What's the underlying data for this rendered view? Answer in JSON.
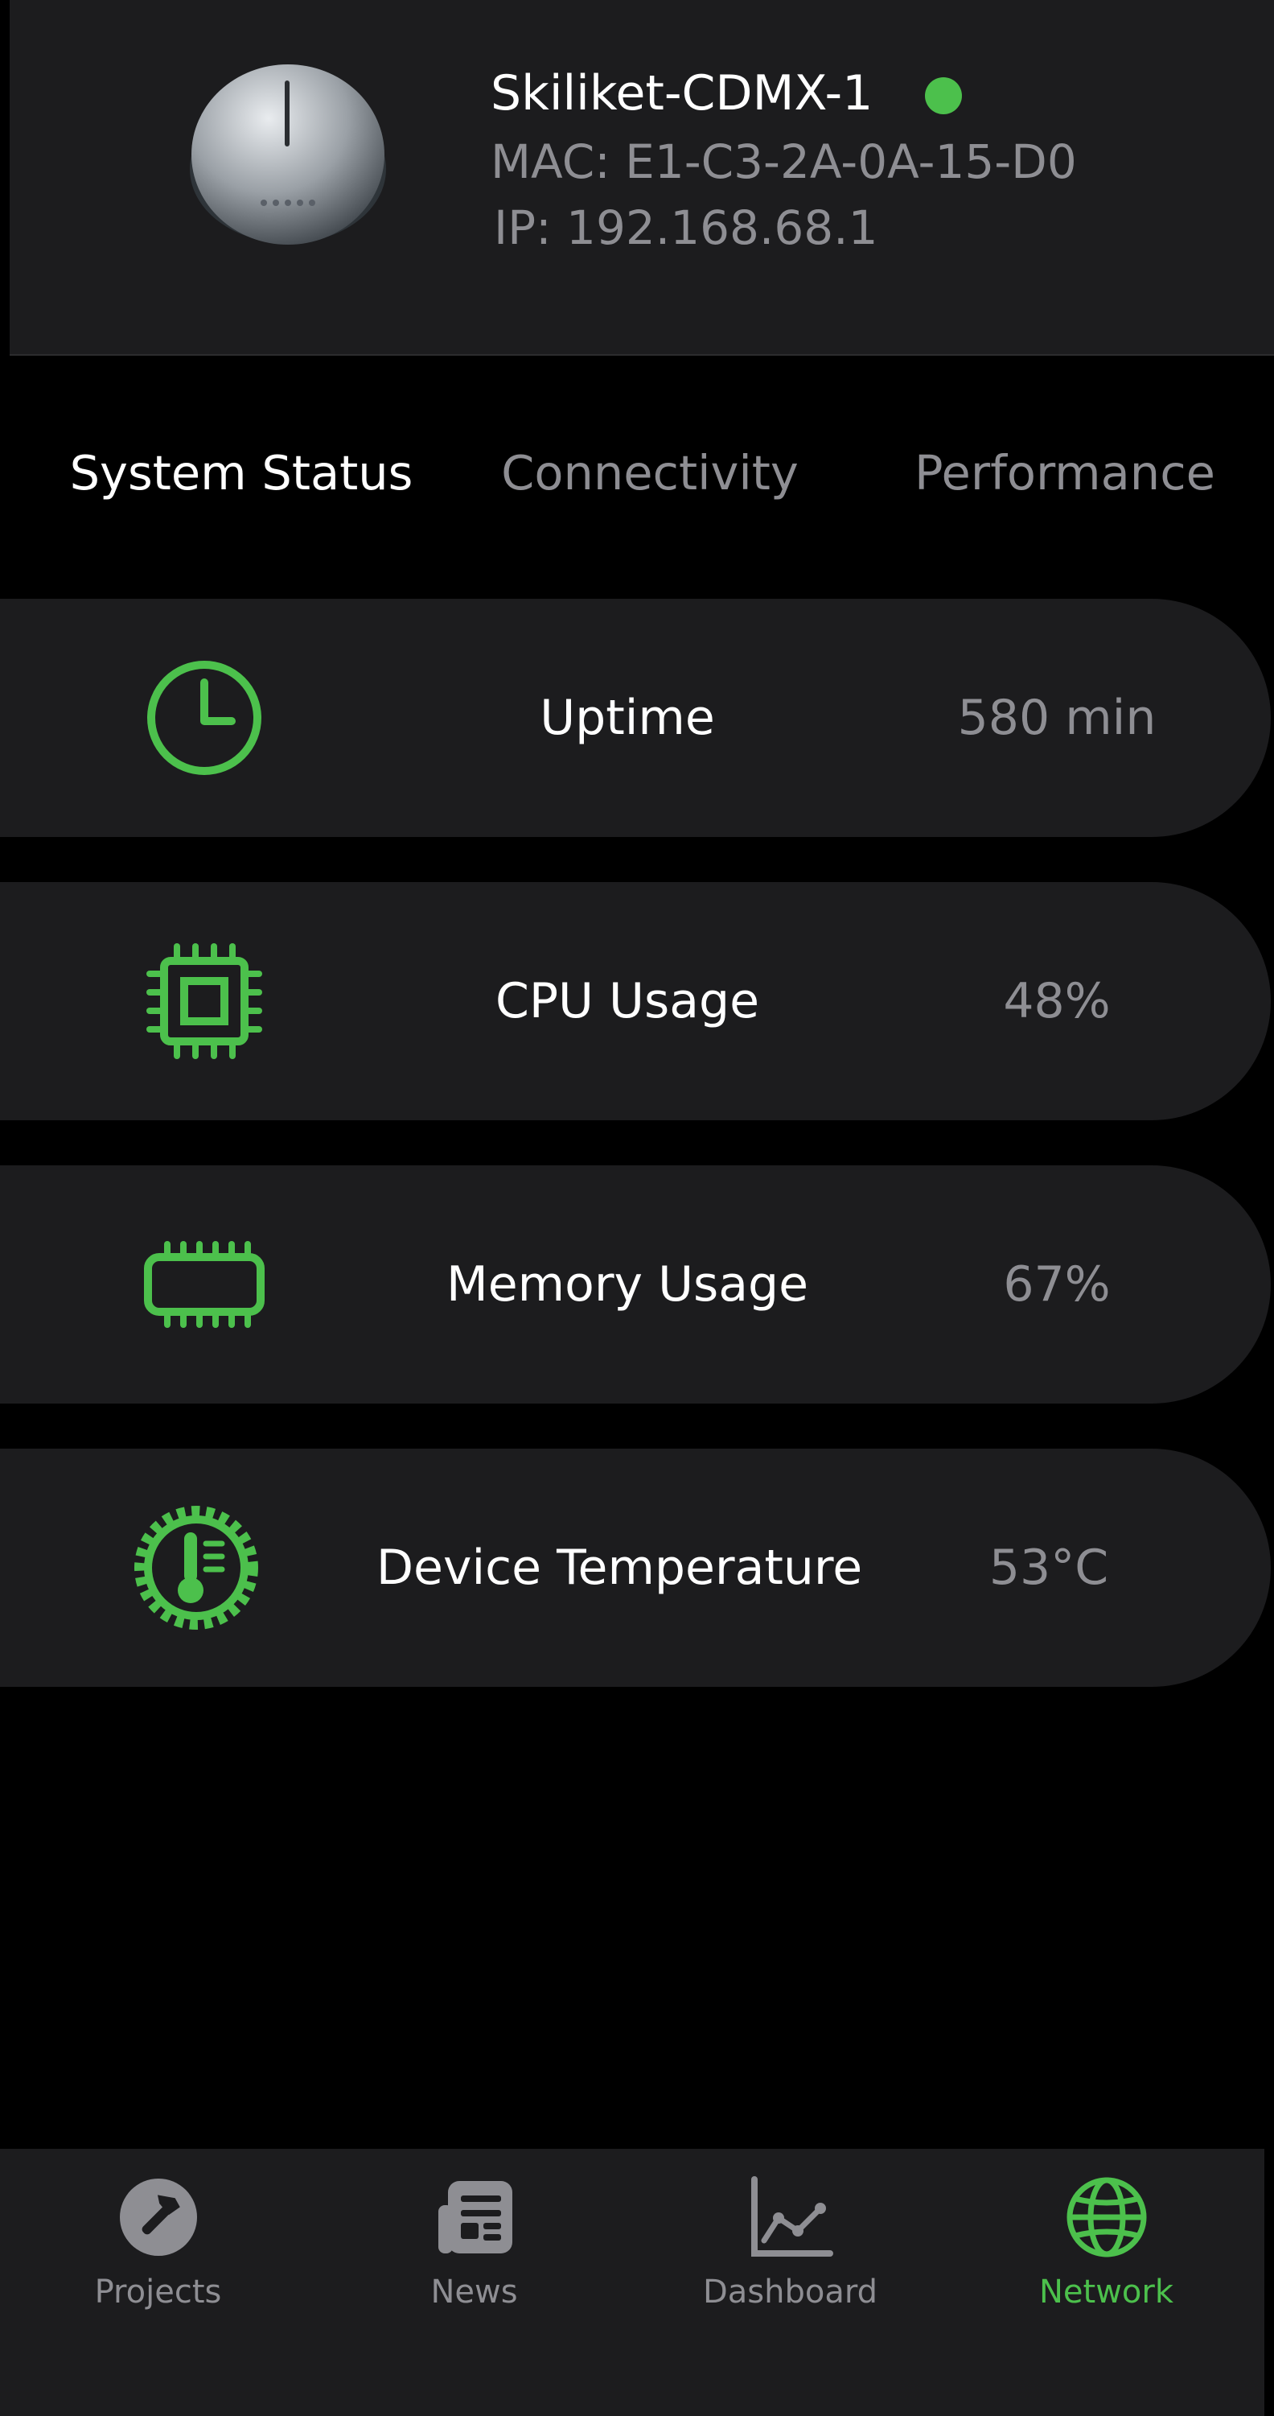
{
  "device": {
    "name": "Skiliket-CDMX-1",
    "mac": "MAC: E1-C3-2A-0A-15-D0",
    "ip": "IP: 192.168.68.1",
    "online_color": "#4cc04c"
  },
  "tabs": [
    {
      "label": "System Status",
      "active": true
    },
    {
      "label": "Connectivity",
      "active": false
    },
    {
      "label": "Performance",
      "active": false
    }
  ],
  "metrics": [
    {
      "icon": "clock-icon",
      "label": "Uptime",
      "value": "580 min"
    },
    {
      "icon": "cpu-icon",
      "label": "CPU Usage",
      "value": "48%"
    },
    {
      "icon": "memory-icon",
      "label": "Memory Usage",
      "value": "67%"
    },
    {
      "icon": "thermometer-gear-icon",
      "label": "Device Temperature",
      "value": "53°C"
    }
  ],
  "bottom_nav": [
    {
      "icon": "hammer-icon",
      "label": "Projects",
      "active": false
    },
    {
      "icon": "newspaper-icon",
      "label": "News",
      "active": false
    },
    {
      "icon": "chart-icon",
      "label": "Dashboard",
      "active": false
    },
    {
      "icon": "globe-icon",
      "label": "Network",
      "active": true
    }
  ],
  "colors": {
    "accent": "#4cc04c",
    "card": "#1c1c1e",
    "muted": "#8e8e93"
  }
}
